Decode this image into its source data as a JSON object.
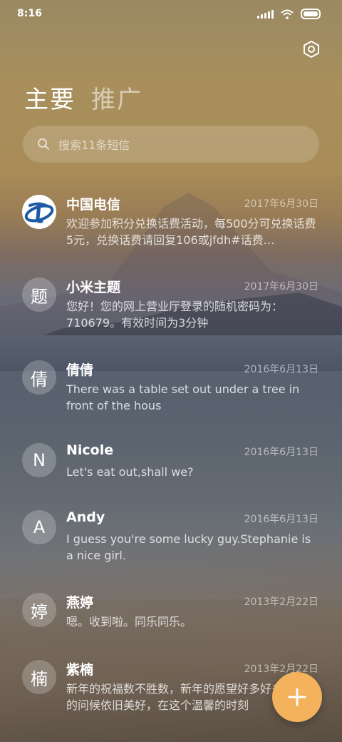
{
  "status_bar": {
    "time": "8:16"
  },
  "tabs": [
    {
      "label": "主要",
      "active": true
    },
    {
      "label": "推广",
      "active": false
    }
  ],
  "search": {
    "placeholder": "搜索11条短信"
  },
  "conversations": [
    {
      "name": "中国电信",
      "date": "2017年6月30日",
      "preview": "欢迎参加积分兑换话费活动，每500分可兑换话费5元，兑换话费请回复106或jfdh#话费…",
      "avatar": "telecom-logo"
    },
    {
      "name": "小米主题",
      "date": "2017年6月30日",
      "preview": "您好！您的网上营业厅登录的随机密码为：710679。有效时间为3分钟",
      "avatar": "题"
    },
    {
      "name": "倩倩",
      "date": "2016年6月13日",
      "preview": "There was a table set out under a tree in front of the hous",
      "avatar": "倩"
    },
    {
      "name": "Nicole",
      "date": "2016年6月13日",
      "preview": "Let's eat out,shall we?",
      "avatar": "N"
    },
    {
      "name": "Andy",
      "date": "2016年6月13日",
      "preview": "I guess you're some lucky guy.Stephanie is a nice girl.",
      "avatar": "A"
    },
    {
      "name": "燕婷",
      "date": "2013年2月22日",
      "preview": "嗯。收到啦。同乐同乐。",
      "avatar": "婷"
    },
    {
      "name": "紫楠",
      "date": "2013年2月22日",
      "preview": "新年的祝福数不胜数，新年的愿望好多好多，新年的问候依旧美好，在这个温馨的时刻",
      "avatar": "楠"
    }
  ],
  "colors": {
    "fab": "#f4b25c",
    "telecom_blue": "#1f5aa6"
  },
  "icons": {
    "settings": "settings-hexagon-icon",
    "search": "search-icon",
    "fab": "plus-icon"
  }
}
